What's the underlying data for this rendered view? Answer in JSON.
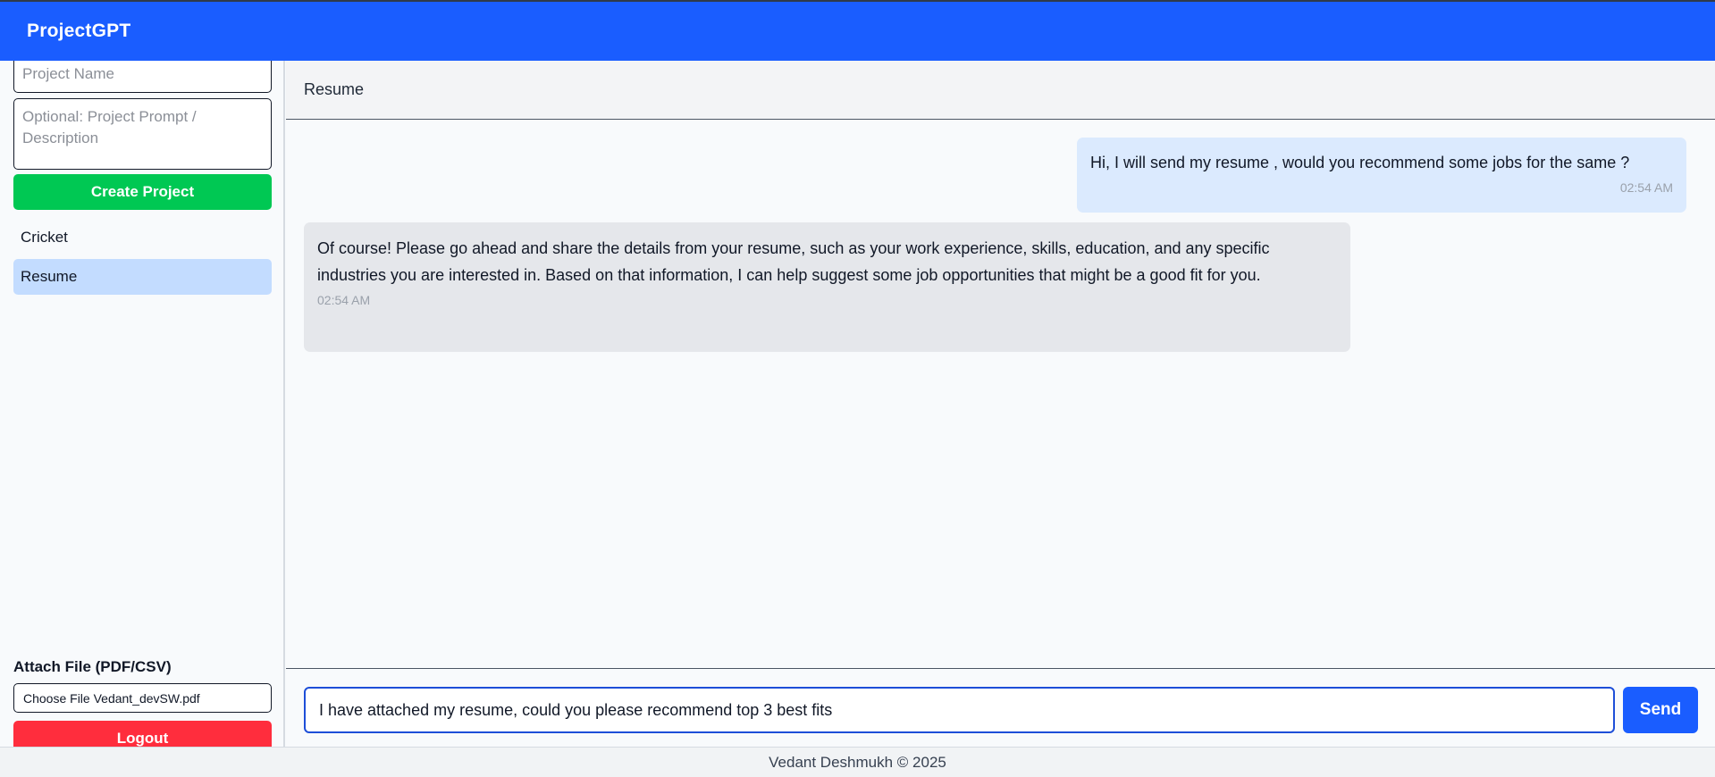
{
  "app": {
    "title": "ProjectGPT"
  },
  "sidebar": {
    "project_name_placeholder": "Project Name",
    "project_prompt_placeholder": "Optional: Project Prompt / Description",
    "create_button": "Create Project",
    "projects": [
      {
        "label": "Cricket",
        "selected": false
      },
      {
        "label": "Resume",
        "selected": true
      }
    ],
    "attach_label": "Attach File (PDF/CSV)",
    "file_input_text": "Choose File Vedant_devSW.pdf",
    "logout_button": "Logout"
  },
  "chat": {
    "title": "Resume",
    "messages": [
      {
        "role": "user",
        "text": "Hi, I will send my resume , would you recommend some jobs for the same ?",
        "time": "02:54 AM"
      },
      {
        "role": "assistant",
        "text": "Of course! Please go ahead and share the details from your resume, such as your work experience, skills, education, and any specific industries you are interested in. Based on that information, I can help suggest some job opportunities that might be a good fit for you.",
        "time": "02:54 AM"
      }
    ],
    "input_value": "I have attached my resume, could you please recommend top 3 best fits",
    "send_button": "Send"
  },
  "footer": {
    "text": "Vedant Deshmukh © 2025"
  },
  "colors": {
    "brand": "#1a5dff",
    "create": "#00c853",
    "logout": "#ff2d3d",
    "selected_project": "#c3dcff",
    "user_bubble": "#dbeafe",
    "assistant_bubble": "#e5e7eb"
  }
}
